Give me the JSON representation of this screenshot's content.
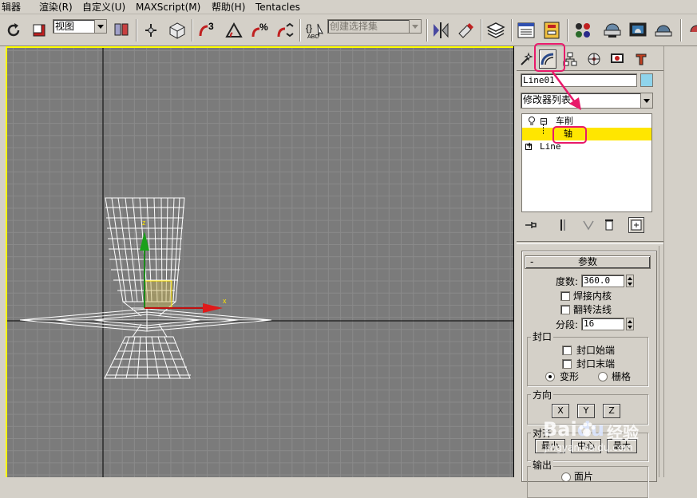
{
  "menu": [
    "辑器",
    "渲染(R)",
    "自定义(U)",
    "MAXScript(M)",
    "帮助(H)",
    "Tentacles"
  ],
  "toolbar": {
    "view_select": "视图",
    "selection_set_placeholder": "创建选择集",
    "snap_label": "3",
    "percent_label": "%"
  },
  "viewport": {
    "axis_x_label": "x",
    "axis_z_label": "z",
    "wire_color": "#ffffff",
    "grid_color": "#7b7b7b",
    "border_color": "#ffff00"
  },
  "command_panel": {
    "object_name": "Line01",
    "object_color": "#8fd4ec",
    "modifier_list": "修改器列表",
    "stack": [
      {
        "label": "车削",
        "expand": "⊟"
      },
      {
        "label": "轴",
        "selected": true
      },
      {
        "label": "Line",
        "expand": "⊞"
      }
    ],
    "rollout_title": "参数",
    "rollout_toggle": "-",
    "degrees_label": "度数:",
    "degrees_value": "360.0",
    "weld_core": "焊接内核",
    "flip_normals": "翻转法线",
    "segments_label": "分段:",
    "segments_value": "16",
    "cap_group": "封口",
    "cap_start": "封口始端",
    "cap_end": "封口末端",
    "morph": "变形",
    "grid": "栅格",
    "direction_group": "方向",
    "dir_x": "X",
    "dir_y": "Y",
    "dir_z": "Z",
    "align_group": "对齐",
    "align_min": "最小",
    "align_center": "中心",
    "align_max": "最大",
    "output_group": "输出",
    "output_patch": "面片"
  },
  "annotation": {
    "highlight_color": "#e8196a"
  },
  "watermark": {
    "brand": "Bai",
    "brand2": "du",
    "cn": "经验",
    "url": "jingyan.baidu.com"
  }
}
